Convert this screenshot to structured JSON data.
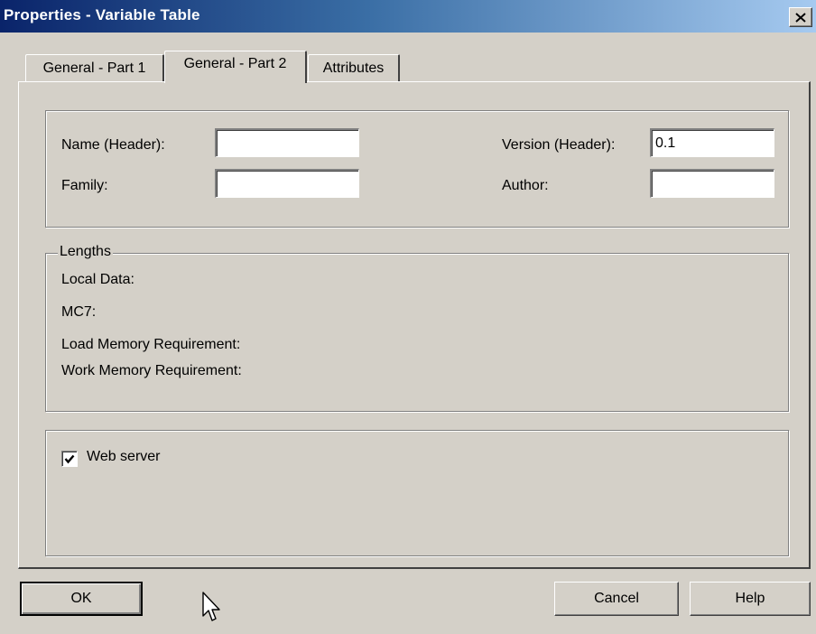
{
  "window": {
    "title": "Properties - Variable Table",
    "close_label": "×"
  },
  "tabs": [
    {
      "label": "General - Part 1",
      "active": false
    },
    {
      "label": "General - Part 2",
      "active": true
    },
    {
      "label": "Attributes",
      "active": false
    }
  ],
  "header_group": {
    "name_label": "Name (Header):",
    "name_value": "",
    "family_label": "Family:",
    "family_value": "",
    "version_label": "Version (Header):",
    "version_value": "0.1",
    "author_label": "Author:",
    "author_value": ""
  },
  "lengths_group": {
    "legend": "Lengths",
    "local_data_label": "Local Data:",
    "mc7_label": "MC7:",
    "load_memory_label": "Load Memory Requirement:",
    "work_memory_label": "Work Memory Requirement:"
  },
  "web_group": {
    "web_server_label": "Web server",
    "web_server_checked": true
  },
  "buttons": {
    "ok": "OK",
    "cancel": "Cancel",
    "help": "Help"
  },
  "icons": {
    "close": "close-icon",
    "check": "check-icon",
    "cursor": "arrow-cursor-icon"
  }
}
